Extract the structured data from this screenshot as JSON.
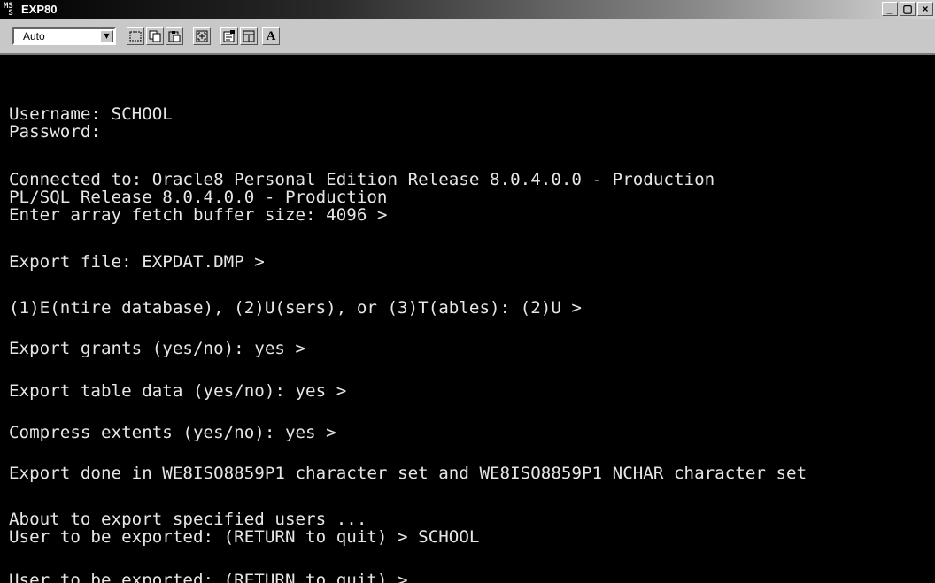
{
  "window": {
    "title": "EXP80",
    "app_icon": "command-prompt-icon",
    "controls": [
      "_",
      "̄",
      "×"
    ]
  },
  "toolbar": {
    "font_size_select": {
      "value": "Auto"
    },
    "buttons": [
      {
        "name": "mark-icon"
      },
      {
        "name": "copy-icon"
      },
      {
        "name": "paste-icon"
      },
      {
        "name": "fullscreen-icon"
      },
      {
        "name": "properties-icon"
      },
      {
        "name": "background-icon"
      },
      {
        "name": "font-icon",
        "label": "A"
      }
    ]
  },
  "terminal": {
    "lines": [
      "Username: SCHOOL",
      "Password:",
      "Connected to: Oracle8 Personal Edition Release 8.0.4.0.0 - Production",
      "PL/SQL Release 8.0.4.0.0 - Production",
      "Enter array fetch buffer size: 4096 >",
      "Export file: EXPDAT.DMP >",
      "(1)E(ntire database), (2)U(sers), or (3)T(ables): (2)U >",
      "Export grants (yes/no): yes >",
      "Export table data (yes/no): yes >",
      "Compress extents (yes/no): yes >",
      "Export done in WE8ISO8859P1 character set and WE8ISO8859P1 NCHAR character set",
      "About to export specified users ...",
      "User to be exported: (RETURN to quit) > SCHOOL",
      "User to be exported: (RETURN to quit) >"
    ]
  }
}
